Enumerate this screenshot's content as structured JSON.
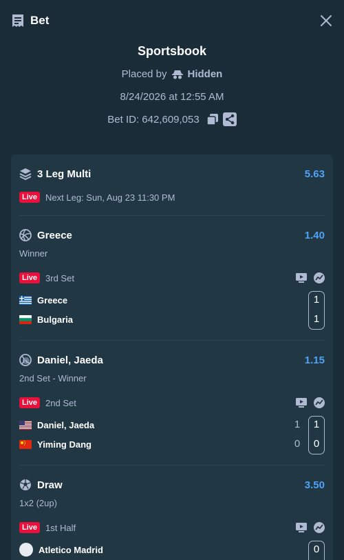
{
  "header": {
    "title": "Bet"
  },
  "info": {
    "sportsbook": "Sportsbook",
    "placed_by_prefix": "Placed by",
    "placed_by_name": "Hidden",
    "datetime": "8/24/2026 at 12:55 AM",
    "bet_id": "Bet ID: 642,609,053"
  },
  "multi": {
    "title": "3 Leg Multi",
    "odds": "5.63",
    "live": "Live",
    "next_leg": "Next Leg: Sun, Aug 23 11:30 PM"
  },
  "legs": [
    {
      "selection": "Greece",
      "odds": "1.40",
      "market": "Winner",
      "live": "Live",
      "status": "3rd Set",
      "teams": [
        {
          "name": "Greece",
          "set_score": "",
          "score": "1"
        },
        {
          "name": "Bulgaria",
          "set_score": "",
          "score": "1"
        }
      ]
    },
    {
      "selection": "Daniel, Jaeda",
      "odds": "1.15",
      "market": "2nd Set - Winner",
      "live": "Live",
      "status": "2nd Set",
      "teams": [
        {
          "name": "Daniel, Jaeda",
          "set_score": "1",
          "score": "1"
        },
        {
          "name": "Yiming Dang",
          "set_score": "0",
          "score": "0"
        }
      ]
    },
    {
      "selection": "Draw",
      "odds": "3.50",
      "market": "1x2 (2up)",
      "live": "Live",
      "status": "1st Half",
      "teams": [
        {
          "name": "Atletico Madrid",
          "set_score": "",
          "score": "0"
        }
      ]
    }
  ],
  "icons": {
    "header": "ticket-icon",
    "close": "close-icon",
    "hidden": "incognito-icon",
    "copy": "copy-icon",
    "share": "share-icon",
    "multi": "layers-icon",
    "leg1": "volleyball-icon",
    "leg2": "tennis-ball-icon",
    "leg3": "soccer-ball-icon",
    "stream": "tv-icon",
    "stats": "stats-icon"
  },
  "colors": {
    "background": "#1a2c38",
    "card": "#213743",
    "accent": "#4fa3f7",
    "live": "#e9113c",
    "muted": "#b1bad3"
  }
}
